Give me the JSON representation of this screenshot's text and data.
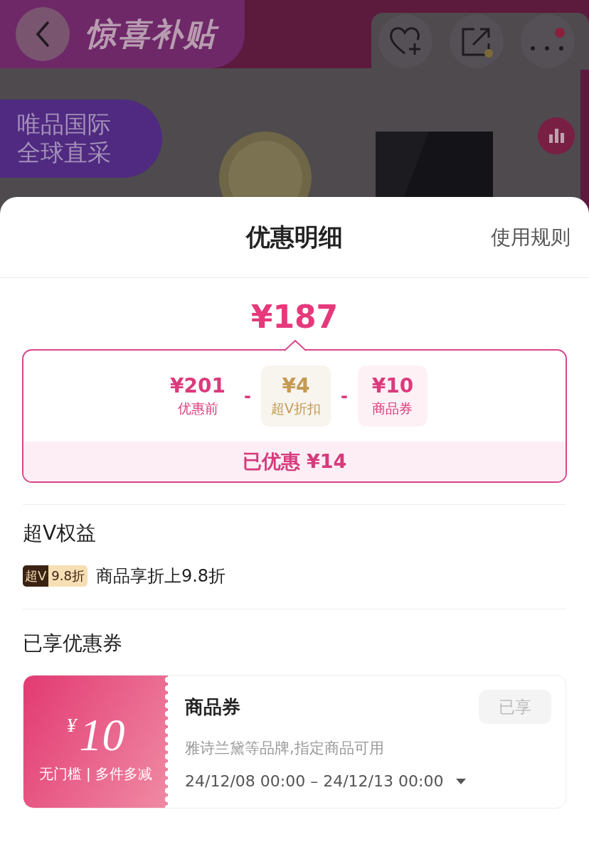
{
  "background_page": {
    "banner_title": "惊喜补贴",
    "promo_tag": [
      "唯品国际",
      "全球直采"
    ]
  },
  "sheet": {
    "title": "优惠明细",
    "rules_link": "使用规则",
    "total": "¥187",
    "breakdown": {
      "items": [
        {
          "kind": "base",
          "amount": "¥201",
          "label": "优惠前"
        },
        {
          "kind": "operator",
          "symbol": "-"
        },
        {
          "kind": "vip",
          "amount": "¥4",
          "label": "超V折扣"
        },
        {
          "kind": "operator",
          "symbol": "-"
        },
        {
          "kind": "coupon",
          "amount": "¥10",
          "label": "商品券"
        }
      ],
      "saved": "已优惠 ¥14"
    },
    "vip_section": {
      "title": "超V权益",
      "badge_left": "超V",
      "badge_right": "9.8折",
      "text": "商品享折上9.8折"
    },
    "coupon_section": {
      "title": "已享优惠券",
      "coupons": [
        {
          "currency": "¥",
          "amount": "10",
          "conditions": "无门槛 | 多件多减",
          "name": "商品券",
          "status": "已享",
          "disabled": true,
          "description": "雅诗兰黛等品牌,指定商品可用",
          "validity": "24/12/08 00:00 – 24/12/13 00:00",
          "expanded": false
        }
      ]
    }
  }
}
